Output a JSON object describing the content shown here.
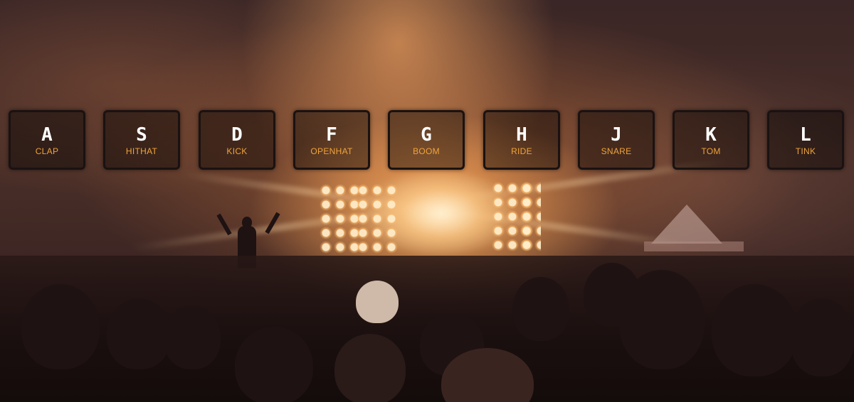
{
  "colors": {
    "key_letter": "#ffffff",
    "key_sound": "#f0a43a",
    "key_border": "#1a1212"
  },
  "background_image": "concert-crowd-stage-lights",
  "drum_keys": [
    {
      "key": "A",
      "sound": "CLAP"
    },
    {
      "key": "S",
      "sound": "HITHAT"
    },
    {
      "key": "D",
      "sound": "KICK"
    },
    {
      "key": "F",
      "sound": "OPENHAT"
    },
    {
      "key": "G",
      "sound": "BOOM"
    },
    {
      "key": "H",
      "sound": "RIDE"
    },
    {
      "key": "J",
      "sound": "SNARE"
    },
    {
      "key": "K",
      "sound": "TOM"
    },
    {
      "key": "L",
      "sound": "TINK"
    }
  ]
}
